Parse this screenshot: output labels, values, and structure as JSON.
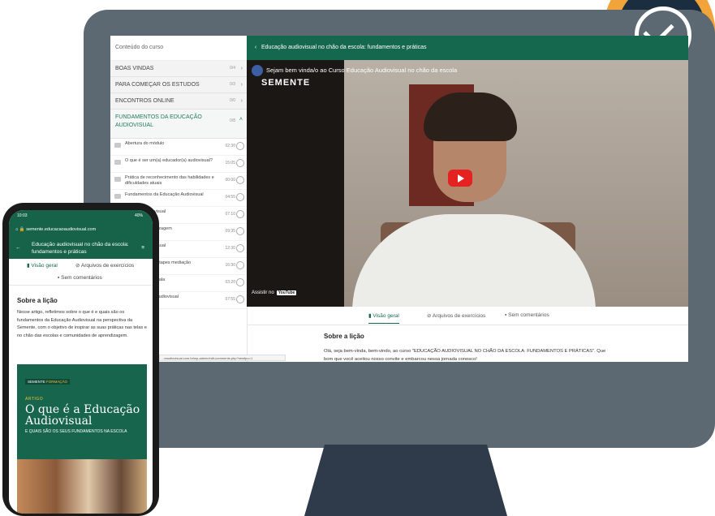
{
  "sidebar": {
    "header": "Conteúdo do curso",
    "sections": [
      {
        "label": "BOAS VINDAS",
        "count": "0/4"
      },
      {
        "label": "PARA COMEÇAR OS ESTUDOS",
        "count": "0/3"
      },
      {
        "label": "ENCONTROS ONLINE",
        "count": "0/0"
      }
    ],
    "active_section": {
      "label": "FUNDAMENTOS DA EDUCAÇÃO AUDIOVISUAL",
      "count": "0/8"
    },
    "lessons": [
      {
        "title": "Abertura do módulo",
        "duration": "02:30"
      },
      {
        "title": "O que é ser um(a) educador(a) audiovisual?",
        "duration": "15:05"
      },
      {
        "title": "Prática de reconhecimento das habilidades e dificuldades atuais",
        "duration": "00:00"
      },
      {
        "title": "Fundamentos da Educação Audiovisual",
        "duration": "04:55"
      },
      {
        "title": "ducação Audiovisual",
        "duration": "07:10"
      },
      {
        "title": "Educação prendizagem",
        "duration": "09:35"
      },
      {
        "title": "ducação Audiovisual",
        "duration": "12:30"
      },
      {
        "title": "o-pedagógicos, etapes mediação",
        "duration": "16:30"
      },
      {
        "title": "om o celular na sala",
        "duration": "03:20"
      },
      {
        "title": "Bases para o o audiovisual",
        "duration": "07:55"
      }
    ]
  },
  "topbar": {
    "title": "Educação audiovisual no chão da escola: fundamentos e práticas"
  },
  "video": {
    "title": "Sejam bem vinda/o ao Curso Educação Audiovisual no chão da escola",
    "logo": "SEMENTE",
    "watch_label": "Assistir no",
    "watch_platform": "YouTube"
  },
  "tabs": {
    "overview": "Visão geral",
    "files": "Arquivos de exercícios",
    "comments": "Sem comentários"
  },
  "about": {
    "title": "Sobre a lição",
    "text": "Olá, seja bem-vinda, bem-vindo, ao curso \"EDUCAÇÃO AUDIOVISUAL NO CHÃO DA ESCOLA: FUNDAMENTOS E PRÁTICAS\". Que bom que você aceitou nosso convite e embarcou nessa jornada conosco!"
  },
  "url_hint": "...eaudiovisual.com.br/wp-admin/edit-comments.php?newfpo=1",
  "phone": {
    "status_time": "10:03",
    "status_right": "40%",
    "url": "semente.educacaoaudiovisual.com",
    "header": "Educação audiovisual no chão da escola: fundamentos e práticas",
    "tab_overview": "Visão geral",
    "tab_files": "Arquivos de exercícios",
    "tab_comments": "Sem comentários",
    "about_title": "Sobre a lição",
    "about_text": "Nesse artigo, refletimos sobre o que é e quais são os fundamentos da Educação Audiovisual na perspectiva da Semente, com o objetivo de inspirar as suas práticas nas telas e no chão das escolas e comunidades de aprendizagem.",
    "card_brand": "SEMENTE",
    "card_brand_tag": "FORMAÇÃO",
    "card_kicker": "ARTIGO",
    "card_title": "O que é a Educação Audiovisual",
    "card_sub": "E QUAIS SÃO OS SEUS FUNDAMENTOS NA ESCOLA"
  },
  "colors": {
    "brand_green": "#15684d",
    "accent_orange": "#f0a43a",
    "youtube_red": "#e52222"
  }
}
